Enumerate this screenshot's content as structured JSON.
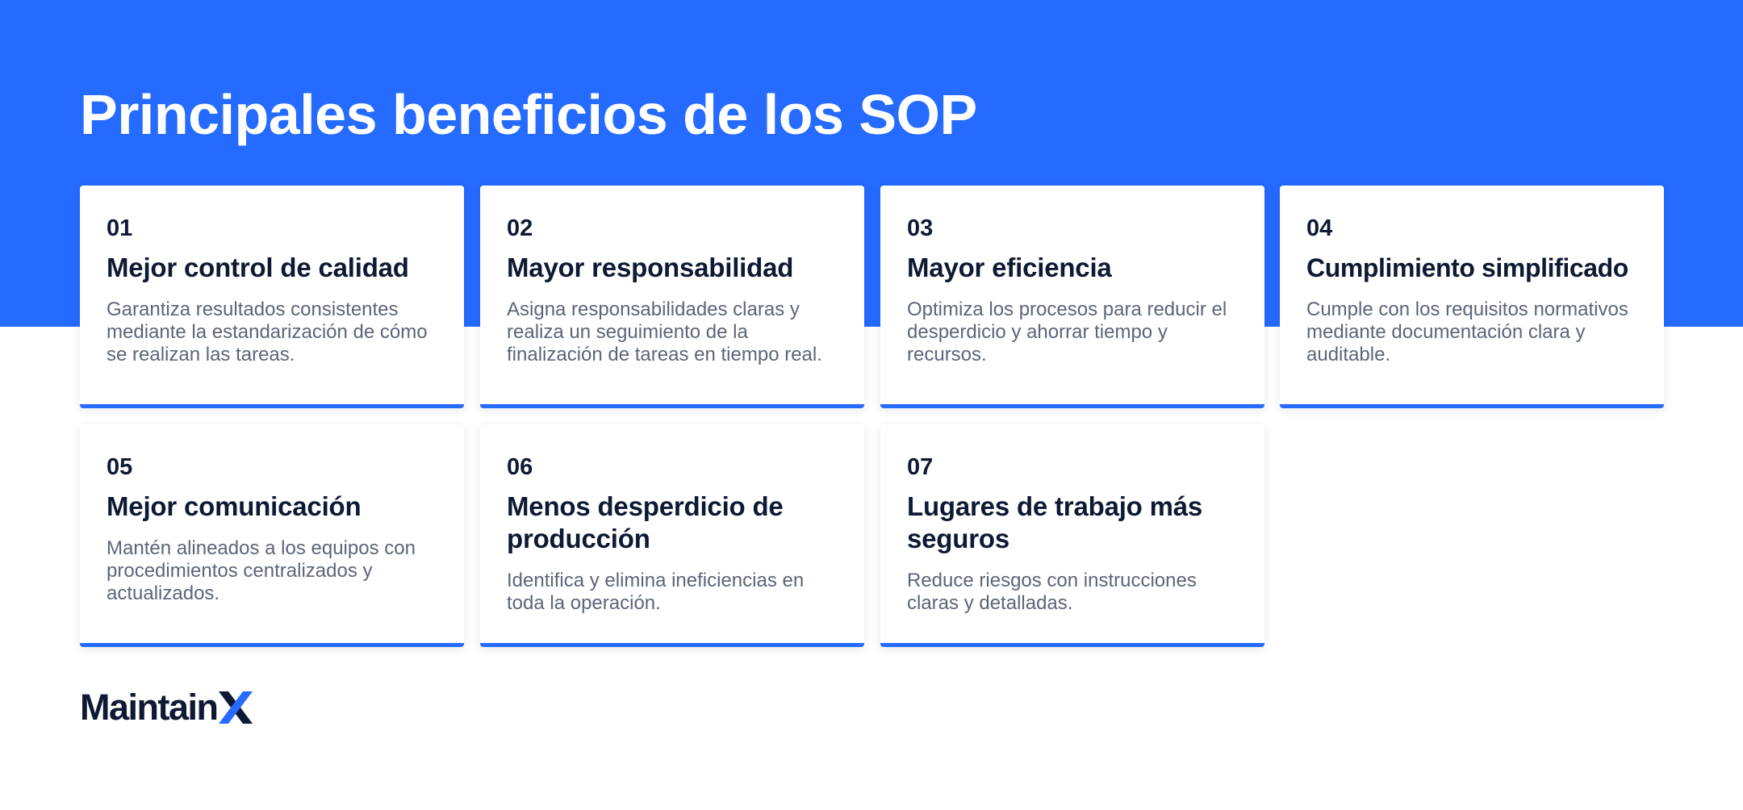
{
  "page": {
    "title": "Principales beneficios de los SOP"
  },
  "cards": [
    {
      "number": "01",
      "title": "Mejor control de calidad",
      "description": "Garantiza resultados consistentes mediante la estandarización de cómo se realizan las tareas."
    },
    {
      "number": "02",
      "title": "Mayor responsabilidad",
      "description": "Asigna responsabilidades claras y realiza un seguimiento de la finalización de tareas en tiempo real."
    },
    {
      "number": "03",
      "title": "Mayor eficiencia",
      "description": "Optimiza los procesos para reducir el desperdicio y ahorrar tiempo y recursos."
    },
    {
      "number": "04",
      "title": "Cumplimiento simplificado",
      "description": "Cumple con los requisitos normativos mediante documentación clara y auditable."
    },
    {
      "number": "05",
      "title": "Mejor comunicación",
      "description": "Mantén alineados a los equipos con procedimientos centralizados y actualizados."
    },
    {
      "number": "06",
      "title": "Menos desperdicio de producción",
      "description": "Identifica y elimina ineficiencias en toda la operación."
    },
    {
      "number": "07",
      "title": "Lugares de trabajo más seguros",
      "description": "Reduce riesgos con instrucciones claras y detalladas."
    }
  ],
  "brand": {
    "name": "MaintainX",
    "wordmark": "Maintain",
    "primary_color": "#256BFF",
    "dark_color": "#0E1A33",
    "text_muted_color": "#5C6578"
  }
}
